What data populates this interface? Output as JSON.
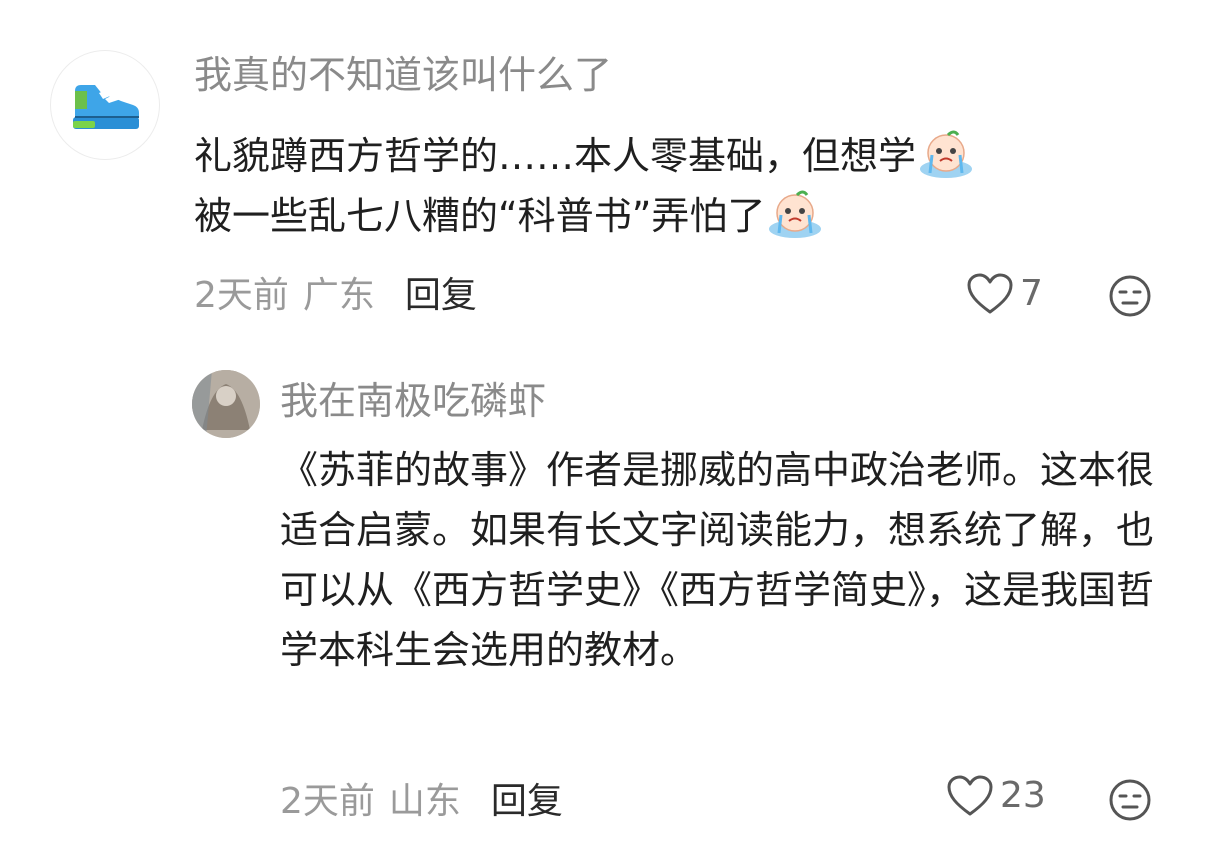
{
  "comments": [
    {
      "username": "我真的不知道该叫什么了",
      "text_line1": "礼貌蹲西方哲学的……本人零基础，但想学",
      "text_line2": "被一些乱七八糟的“科普书”弄怕了",
      "time": "2天前",
      "location": "广东",
      "reply_label": "回复",
      "likes": "7"
    },
    {
      "username": "我在南极吃磷虾",
      "text": "《苏菲的故事》作者是挪威的高中政治老师。这本很适合启蒙。如果有长文字阅读能力，想系统了解，也可以从《西方哲学史》《西方哲学简史》，这是我国哲学本科生会选用的教材。",
      "time": "2天前",
      "location": "山东",
      "reply_label": "回复",
      "likes": "23"
    }
  ],
  "icons": {
    "like": "heart-outline-icon",
    "more": "neutral-face-icon",
    "emoji": "crying-peach-emoji",
    "avatar1": "sneaker-icon"
  },
  "colors": {
    "username": "#8a8a8a",
    "meta": "#9a9a9a",
    "text": "#1f1f1f"
  }
}
